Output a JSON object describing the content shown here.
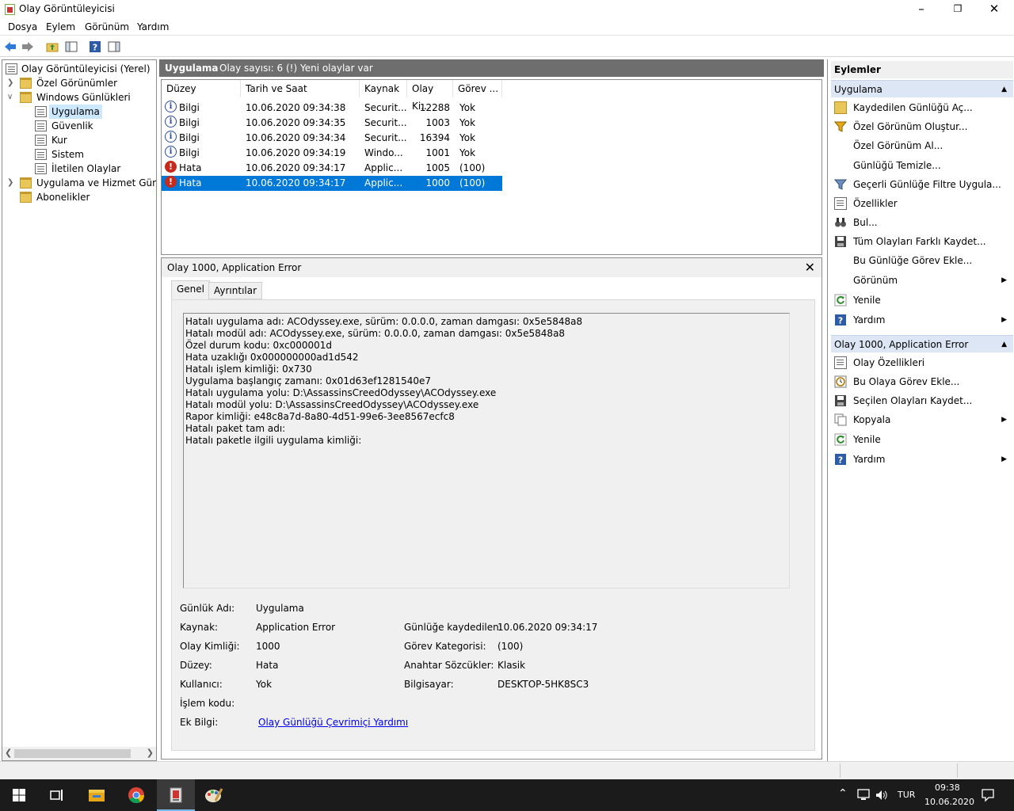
{
  "window": {
    "title": "Olay Görüntüleyicisi"
  },
  "menu": [
    "Dosya",
    "Eylem",
    "Görünüm",
    "Yardım"
  ],
  "tree": {
    "root": "Olay Görüntüleyicisi (Yerel)",
    "items": [
      "Özel Görünümler",
      "Windows Günlükleri",
      "Uygulama",
      "Güvenlik",
      "Kur",
      "Sistem",
      "İletilen Olaylar",
      "Uygulama ve Hizmet Günlük",
      "Abonelikler"
    ]
  },
  "list_header": {
    "title": "Uygulama",
    "info": "Olay sayısı: 6 (!) Yeni olaylar var"
  },
  "columns": [
    "Düzey",
    "Tarih ve Saat",
    "Kaynak",
    "Olay Ki...",
    "Görev ..."
  ],
  "events": [
    {
      "level": "Bilgi",
      "date": "10.06.2020 09:34:38",
      "source": "Securit...",
      "id": "12288",
      "task": "Yok"
    },
    {
      "level": "Bilgi",
      "date": "10.06.2020 09:34:35",
      "source": "Securit...",
      "id": "1003",
      "task": "Yok"
    },
    {
      "level": "Bilgi",
      "date": "10.06.2020 09:34:34",
      "source": "Securit...",
      "id": "16394",
      "task": "Yok"
    },
    {
      "level": "Bilgi",
      "date": "10.06.2020 09:34:19",
      "source": "Windo...",
      "id": "1001",
      "task": "Yok"
    },
    {
      "level": "Hata",
      "date": "10.06.2020 09:34:17",
      "source": "Applic...",
      "id": "1005",
      "task": "(100)"
    },
    {
      "level": "Hata",
      "date": "10.06.2020 09:34:17",
      "source": "Applic...",
      "id": "1000",
      "task": "(100)"
    }
  ],
  "detail": {
    "title": "Olay 1000, Application Error",
    "tabs": [
      "Genel",
      "Ayrıntılar"
    ],
    "description": [
      "Hatalı uygulama adı: ACOdyssey.exe, sürüm: 0.0.0.0, zaman damgası: 0x5e5848a8",
      "Hatalı modül adı: ACOdyssey.exe, sürüm: 0.0.0.0, zaman damgası: 0x5e5848a8",
      "Özel durum kodu: 0xc000001d",
      "Hata uzaklığı 0x000000000ad1d542",
      "Hatalı işlem kimliği: 0x730",
      "Uygulama başlangıç zamanı: 0x01d63ef1281540e7",
      "Hatalı uygulama yolu: D:\\AssassinsCreedOdyssey\\ACOdyssey.exe",
      "Hatalı modül yolu: D:\\AssassinsCreedOdyssey\\ACOdyssey.exe",
      "Rapor kimliği: e48c8a7d-8a80-4d51-99e6-3ee8567ecfc8",
      "Hatalı paket tam adı:",
      "Hatalı paketle ilgili uygulama kimliği:"
    ],
    "fields": {
      "log_name_label": "Günlük Adı:",
      "log_name": "Uygulama",
      "source_label": "Kaynak:",
      "source": "Application Error",
      "logged_label": "Günlüğe kaydedilen:",
      "logged": "10.06.2020 09:34:17",
      "event_id_label": "Olay Kimliği:",
      "event_id": "1000",
      "task_cat_label": "Görev Kategorisi:",
      "task_cat": "(100)",
      "level_label": "Düzey:",
      "level": "Hata",
      "keywords_label": "Anahtar Sözcükler:",
      "keywords": "Klasik",
      "user_label": "Kullanıcı:",
      "user": "Yok",
      "computer_label": "Bilgisayar:",
      "computer": "DESKTOP-5HK8SC3",
      "opcode_label": "İşlem kodu:",
      "more_info_label": "Ek Bilgi:",
      "more_info_link": "Olay Günlüğü Çevrimiçi Yardımı"
    }
  },
  "actions": {
    "title": "Eylemler",
    "section1": "Uygulama",
    "section1_items": [
      "Kaydedilen Günlüğü Aç...",
      "Özel Görünüm Oluştur...",
      "Özel Görünüm Al...",
      "Günlüğü Temizle...",
      "Geçerli Günlüğe Filtre Uygula...",
      "Özellikler",
      "Bul...",
      "Tüm Olayları Farklı Kaydet...",
      "Bu Günlüğe Görev Ekle...",
      "Görünüm",
      "Yenile",
      "Yardım"
    ],
    "section2": "Olay 1000, Application Error",
    "section2_items": [
      "Olay Özellikleri",
      "Bu Olaya Görev Ekle...",
      "Seçilen Olayları Kaydet...",
      "Kopyala",
      "Yenile",
      "Yardım"
    ]
  },
  "taskbar": {
    "lang": "TUR",
    "time": "09:38",
    "date": "10.06.2020"
  },
  "colors": {
    "selection": "#0078d7",
    "header": "#6e6e6e",
    "section": "#dce6f4",
    "error": "#c42b1c"
  }
}
